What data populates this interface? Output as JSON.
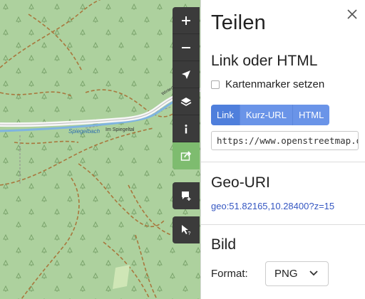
{
  "map": {
    "labels": {
      "stream_1": "Spiegelbach",
      "stream_2": "Im Spiegeltal",
      "road": "Winterbergstraße"
    }
  },
  "controls": [
    {
      "name": "zoom-in-button",
      "icon": "plus-icon"
    },
    {
      "name": "zoom-out-button",
      "icon": "minus-icon"
    },
    {
      "name": "locate-button",
      "icon": "location-arrow-icon"
    },
    {
      "name": "layers-button",
      "icon": "layers-icon"
    },
    {
      "name": "info-button",
      "icon": "info-icon"
    },
    {
      "name": "share-button",
      "icon": "share-icon",
      "active": true
    },
    {
      "name": "add-note-button",
      "icon": "comment-add-icon"
    },
    {
      "name": "query-features-button",
      "icon": "cursor-question-icon"
    }
  ],
  "sidebar": {
    "title": "Teilen",
    "link_section": {
      "heading": "Link oder HTML",
      "marker_checkbox_label": "Kartenmarker setzen",
      "tabs": [
        "Link",
        "Kurz-URL",
        "HTML"
      ],
      "active_tab": "Link",
      "url_value": "https://www.openstreetmap.org/"
    },
    "geo_section": {
      "heading": "Geo-URI",
      "uri": "geo:51.82165,10.28400?z=15"
    },
    "image_section": {
      "heading": "Bild",
      "format_label": "Format:",
      "format_value": "PNG"
    }
  },
  "colors": {
    "map_forest": "#add19e",
    "control_bg": "#3b3b3b",
    "control_active": "#7ebc6f",
    "tab_bg": "#6a94e8",
    "link": "#3557c2"
  }
}
